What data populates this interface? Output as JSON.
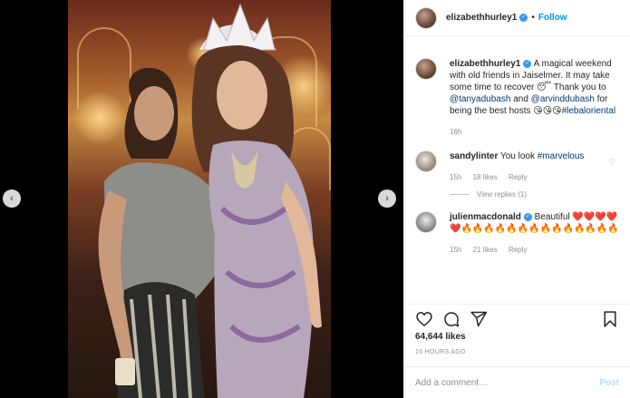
{
  "post": {
    "username": "elizabethhurley1",
    "verified_mark": "✓",
    "separator": "•",
    "follow_label": "Follow"
  },
  "caption": {
    "username": "elizabethhurley1",
    "text_1": " A magical weekend with old friends in Jaiselmer. It may take some time to recover 😴 Thank you to ",
    "mention_1": "@tanyadubash",
    "text_2": " and ",
    "mention_2": "@arvinddubash",
    "text_3": " for being the best hosts 😘😘😘",
    "hashtag": "#lebaloriental",
    "time": "16h"
  },
  "comments": [
    {
      "username": "sandylinter",
      "text": " You look ",
      "hashtag": "#marvelous",
      "time": "15h",
      "likes": "18 likes",
      "reply": "Reply",
      "view_replies": "View replies (1)"
    },
    {
      "username": "julienmacdonald",
      "text": " Beautiful ❤️❤️❤️❤️❤️🔥🔥🔥🔥🔥🔥🔥🔥🔥🔥🔥🔥🔥🔥",
      "time": "15h",
      "likes": "21 likes",
      "reply": "Reply"
    }
  ],
  "icons": {
    "heart": "heart-icon",
    "comment": "comment-icon",
    "share": "share-icon",
    "bookmark": "bookmark-icon",
    "prev": "chevron-left-icon",
    "next": "chevron-right-icon"
  },
  "carousel": {
    "prev_glyph": "‹",
    "next_glyph": "›"
  },
  "likes_count": "64,644 likes",
  "timestamp": "16 HOURS AGO",
  "add_comment": {
    "placeholder": "Add a comment…",
    "post_label": "Post"
  },
  "colors": {
    "accent": "#0095f6",
    "verified": "#3897f0",
    "link": "#00376b",
    "muted": "#8e8e8e",
    "post_disabled": "#b2dffc"
  }
}
